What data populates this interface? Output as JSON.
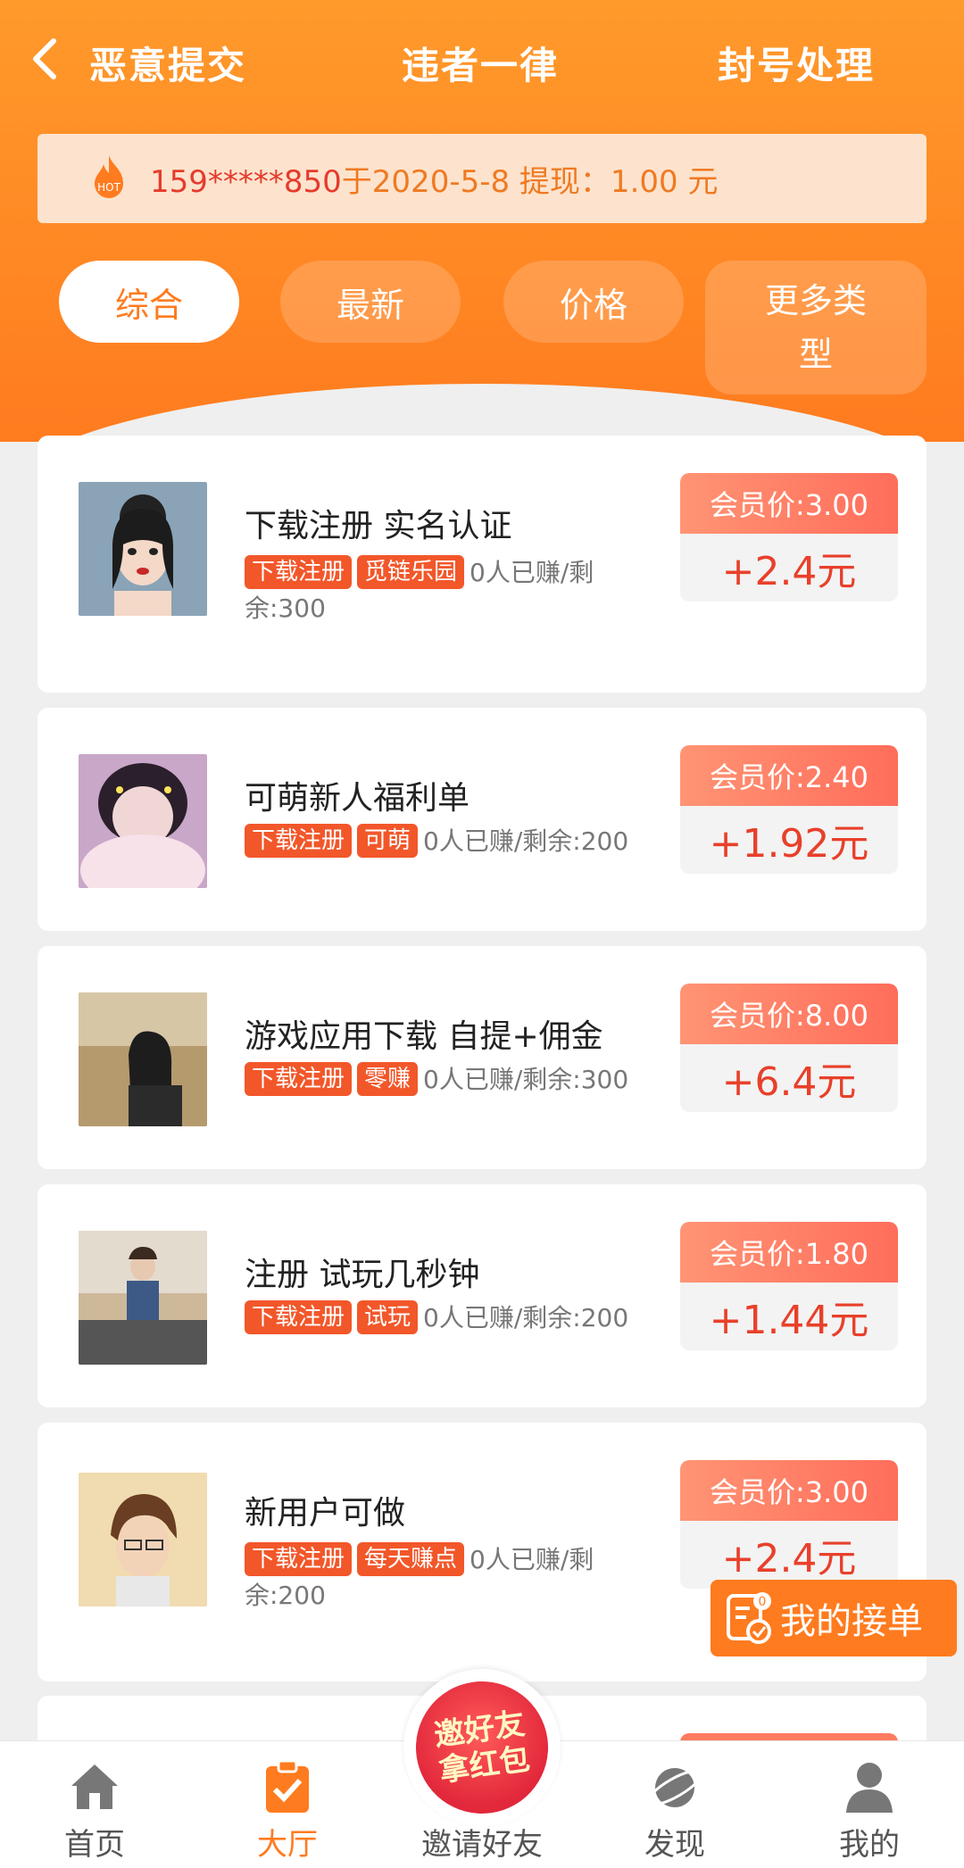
{
  "header": {
    "titles": [
      "恶意提交",
      "违者一律",
      "封号处理"
    ]
  },
  "notice": {
    "phone": "159*****850",
    "rest": "于2020-5-8 提现：1.00 元"
  },
  "tabs": [
    {
      "label": "综合"
    },
    {
      "label": "最新"
    },
    {
      "label": "价格"
    },
    {
      "label": "更多类\n型"
    }
  ],
  "tasks": [
    {
      "title": "下载注册 实名认证",
      "tags": [
        "下载注册",
        "觅链乐园"
      ],
      "stat": "0人已赚/剩余:300",
      "member_price": "会员价:3.00",
      "reward": "+2.4元"
    },
    {
      "title": "可萌新人福利单",
      "tags": [
        "下载注册",
        "可萌"
      ],
      "stat": "0人已赚/剩余:200",
      "member_price": "会员价:2.40",
      "reward": "+1.92元"
    },
    {
      "title": "游戏应用下载 自提+佣金",
      "tags": [
        "下载注册",
        "零赚"
      ],
      "stat": "0人已赚/剩余:300",
      "member_price": "会员价:8.00",
      "reward": "+6.4元"
    },
    {
      "title": "注册 试玩几秒钟",
      "tags": [
        "下载注册",
        "试玩"
      ],
      "stat": "0人已赚/剩余:200",
      "member_price": "会员价:1.80",
      "reward": "+1.44元"
    },
    {
      "title": "新用户可做",
      "tags": [
        "下载注册",
        "每天赚点"
      ],
      "stat": "0人已赚/剩余:200",
      "member_price": "会员价:3.00",
      "reward": "+2.4元"
    }
  ],
  "float_button": {
    "label": "我的接单",
    "badge": "0"
  },
  "invite": {
    "label": "邀好友拿红包"
  },
  "nav": [
    {
      "label": "首页"
    },
    {
      "label": "大厅"
    },
    {
      "label": "邀请好友"
    },
    {
      "label": "发现"
    },
    {
      "label": "我的"
    }
  ],
  "colors": {
    "brand_orange": "#ff7b1f",
    "price_red": "#e8402b",
    "tag_red": "#f2572a"
  }
}
